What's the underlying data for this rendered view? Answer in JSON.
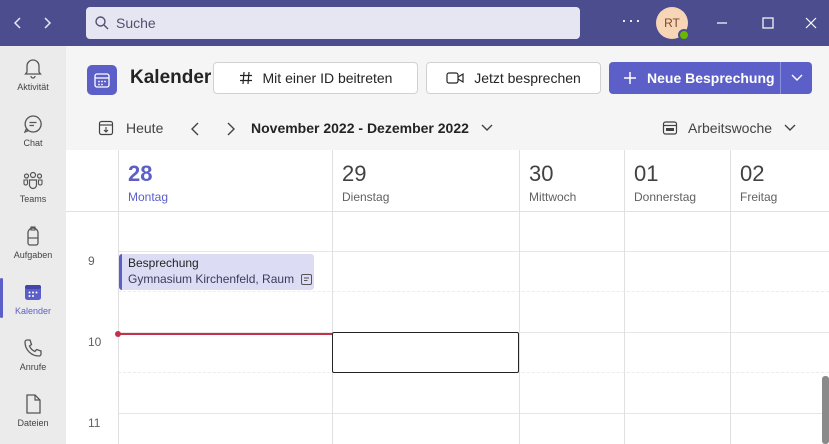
{
  "search": {
    "placeholder": "Suche"
  },
  "user": {
    "initials": "RT"
  },
  "rail": [
    {
      "label": "Aktivität",
      "icon": "bell-icon"
    },
    {
      "label": "Chat",
      "icon": "chat-icon"
    },
    {
      "label": "Teams",
      "icon": "teams-icon"
    },
    {
      "label": "Aufgaben",
      "icon": "tasks-icon"
    },
    {
      "label": "Kalender",
      "icon": "calendar-icon",
      "active": true
    },
    {
      "label": "Anrufe",
      "icon": "phone-icon"
    },
    {
      "label": "Dateien",
      "icon": "file-icon"
    }
  ],
  "header": {
    "title": "Kalender",
    "join_label": "Mit einer ID beitreten",
    "meet_now_label": "Jetzt besprechen",
    "new_meeting_label": "Neue Besprechung"
  },
  "toolbar": {
    "today_label": "Heute",
    "range_label": "November 2022 - Dezember 2022",
    "view_label": "Arbeitswoche"
  },
  "days": [
    {
      "num": "28",
      "name": "Montag",
      "today": true
    },
    {
      "num": "29",
      "name": "Dienstag"
    },
    {
      "num": "30",
      "name": "Mittwoch"
    },
    {
      "num": "01",
      "name": "Donnerstag"
    },
    {
      "num": "02",
      "name": "Freitag"
    }
  ],
  "hours": [
    "9",
    "10",
    "11"
  ],
  "event": {
    "title": "Besprechung",
    "location": "Gymnasium Kirchenfeld, Raum"
  },
  "colors": {
    "accent": "#5b5fc7",
    "titlebar": "#4b4d8f",
    "now_line": "#c4314b"
  }
}
